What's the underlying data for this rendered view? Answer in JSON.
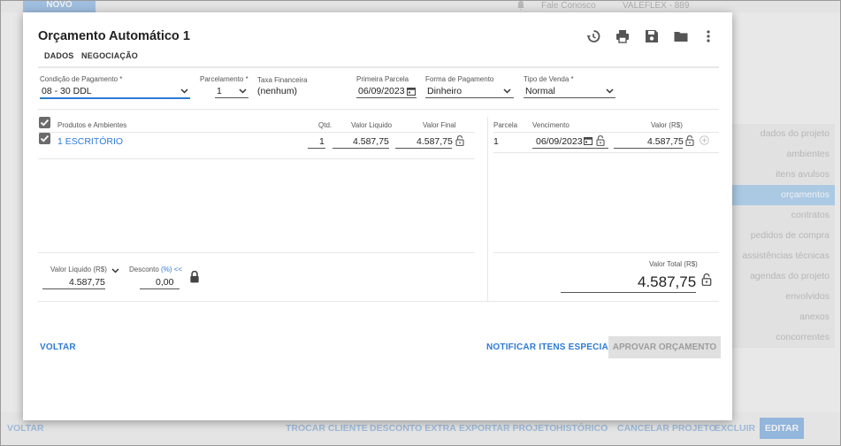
{
  "background": {
    "novo_label": "NOVO",
    "contact_label": "Fale Conosco",
    "store_label": "VALEFLEX - 889",
    "sidebar": [
      "dados do projeto",
      "ambientes",
      "itens avulsos",
      "orçamentos",
      "contratos",
      "pedidos de compra",
      "assistências técnicas",
      "agendas do projeto",
      "envolvidos",
      "anexos",
      "concorrentes"
    ],
    "sidebar_active": "orçamentos",
    "bottom": {
      "voltar": "VOLTAR",
      "trocar_cliente": "TROCAR CLIENTE",
      "desconto_extra": "DESCONTO EXTRA",
      "exportar_projeto": "EXPORTAR PROJETO",
      "historico": "HISTÓRICO",
      "cancelar_projeto": "CANCELAR PROJETO",
      "excluir": "EXCLUIR",
      "editar": "EDITAR"
    }
  },
  "modal": {
    "title": "Orçamento Automático 1",
    "toolbar_icons": [
      "history-icon",
      "print-icon",
      "save-icon",
      "folder-icon",
      "more-vert-icon"
    ],
    "tabs": [
      "DADOS",
      "NEGOCIAÇÃO"
    ],
    "fields": {
      "condicao": {
        "label": "Condição de Pagamento *",
        "value": "08 - 30 DDL"
      },
      "parcelamento": {
        "label": "Parcelamento *",
        "value": "1"
      },
      "taxa": {
        "label": "Taxa Financeira",
        "value": "(nenhum)"
      },
      "primeira_parcela": {
        "label": "Primeira Parcela",
        "value": "06/09/2023"
      },
      "forma": {
        "label": "Forma de Pagamento",
        "value": "Dinheiro"
      },
      "tipo_venda": {
        "label": "Tipo de Venda *",
        "value": "Normal"
      }
    },
    "products_table": {
      "headers": {
        "produto": "Produtos e Ambientes",
        "qtd": "Qtd.",
        "valor_liquido": "Valor Liquido",
        "valor_final": "Valor Final"
      },
      "rows": [
        {
          "produto": "1 ESCRITÓRIO",
          "qtd": "1",
          "valor_liquido": "4.587,75",
          "valor_final": "4.587,75"
        }
      ]
    },
    "parcelas_table": {
      "headers": {
        "parcela": "Parcela",
        "vencimento": "Vencimento",
        "valor": "Valor (R$)"
      },
      "rows": [
        {
          "parcela": "1",
          "vencimento": "06/09/2023",
          "valor": "4.587,75"
        }
      ]
    },
    "summary": {
      "valor_liquido_label": "Valor Liquido (R$)",
      "valor_liquido": "4.587,75",
      "desconto_label": "Desconto",
      "desconto_pct": "(%)",
      "desconto_arrows": "<<",
      "desconto": "0,00",
      "valor_total_label": "Valor Total (R$)",
      "valor_total": "4.587,75"
    },
    "actions": {
      "voltar": "VOLTAR",
      "notificar": "NOTIFICAR ITENS ESPECIAIS",
      "aprovar": "APROVAR ORÇAMENTO"
    }
  },
  "colors": {
    "accent": "#2e7bd6",
    "active_sidebar": "#b6d6f2",
    "disabled_button": "#e0e0e0"
  }
}
